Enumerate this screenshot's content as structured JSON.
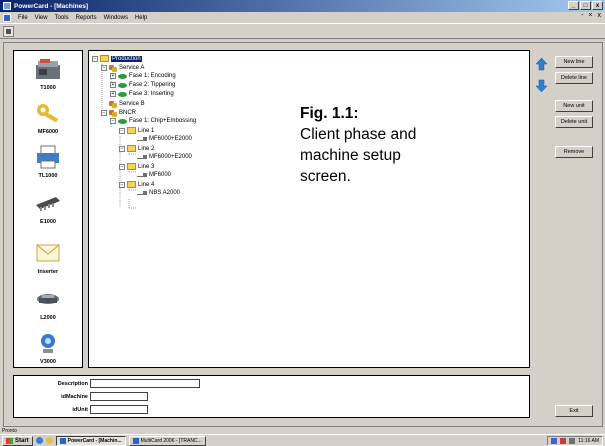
{
  "window": {
    "title": "PowerCard - [Machines]",
    "controls": [
      "_",
      "□",
      "x"
    ],
    "mdi_controls": [
      "-",
      "×",
      "x"
    ]
  },
  "menu": [
    "File",
    "View",
    "Tools",
    "Reports",
    "Windows",
    "Help"
  ],
  "machines": [
    {
      "label": "T1000",
      "icon": "t1000-machine-icon"
    },
    {
      "label": "MF6000",
      "icon": "mf6000-machine-icon"
    },
    {
      "label": "TL1000",
      "icon": "tl1000-machine-icon"
    },
    {
      "label": "E1000",
      "icon": "e1000-machine-icon"
    },
    {
      "label": "Inserter",
      "icon": "inserter-envelope-icon"
    },
    {
      "label": "L2000",
      "icon": "l2000-machine-icon"
    },
    {
      "label": "V3000",
      "icon": "v3000-camera-icon"
    }
  ],
  "tree": [
    {
      "label": "Production",
      "icon": "folder",
      "expander": "−",
      "selected": true
    },
    {
      "label": "Service A",
      "icon": "service",
      "expander": "−"
    },
    {
      "label": "Fase 1: Encoding",
      "icon": "phase",
      "expander": "+"
    },
    {
      "label": "Fase 2: Tippering",
      "icon": "phase",
      "expander": "+"
    },
    {
      "label": "Fase 3: Inserting",
      "icon": "phase",
      "expander": "+"
    },
    {
      "label": "Service B",
      "icon": "service",
      "expander": ""
    },
    {
      "label": "BNCR",
      "icon": "service",
      "expander": "−"
    },
    {
      "label": "Fase 1: Chip+Embossing",
      "icon": "phase",
      "expander": "−"
    },
    {
      "label": "Line 1",
      "icon": "folder",
      "expander": "−"
    },
    {
      "label": "MF6000+E2000",
      "icon": "machine",
      "expander": ""
    },
    {
      "label": "Line 2",
      "icon": "folder",
      "expander": "−"
    },
    {
      "label": "MF6000+E2000",
      "icon": "machine",
      "expander": ""
    },
    {
      "label": "Line 3",
      "icon": "folder",
      "expander": "−"
    },
    {
      "label": "MF6000",
      "icon": "machine",
      "expander": ""
    },
    {
      "label": "Line 4",
      "icon": "folder",
      "expander": "−"
    },
    {
      "label": "NBS A2000",
      "icon": "machine",
      "expander": ""
    }
  ],
  "caption": {
    "title": "Fig. 1.1:",
    "lines": [
      "Client phase and",
      "machine setup",
      "screen."
    ]
  },
  "buttons": {
    "new_line": "New line",
    "delete_line": "Delete line",
    "new_unit": "New unit",
    "delete_unit": "Delete unit",
    "remove": "Remove",
    "exit": "Exit"
  },
  "details": {
    "description_label": "Description",
    "description_value": "",
    "idmachine_label": "idMachine",
    "idmachine_value": "",
    "idunit_label": "idUnit",
    "idunit_value": ""
  },
  "status": "Pronto",
  "taskbar": {
    "start": "Start",
    "tasks": [
      "PowerCard - [Machin...",
      "MultiCard 2006 - [TRANC..."
    ],
    "clock": "11:16 AM"
  },
  "colors": {
    "titlebar": "#0a246a",
    "selection": "#0a246a",
    "arrow": "#2d7fd6",
    "folder": "#f5d35a"
  }
}
